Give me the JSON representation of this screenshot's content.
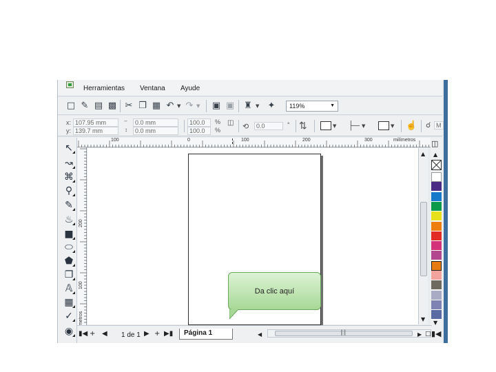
{
  "menu": [
    "Herramientas",
    "Ventana",
    "Ayude"
  ],
  "toolbar": {
    "zoom_value": "119%"
  },
  "property_bar": {
    "x_label": "x:",
    "x_value": "107.95 mm",
    "y_label": "y:",
    "y_value": "139.7 mm",
    "w_value": "0.0 mm",
    "h_value": "0.0 mm",
    "scale_x": "100.0",
    "scale_y": "100.0",
    "percent_x": "%",
    "percent_y": "%",
    "rotation_value": "0.0",
    "degree_symbol": "°",
    "font_partial": "M"
  },
  "ruler": {
    "top_labels": [
      "100",
      "0",
      "100",
      "200",
      "300"
    ],
    "top_unit": "milímetros",
    "left_labels": [
      "200",
      "100"
    ],
    "left_unit": "milímetros"
  },
  "canvas": {
    "callout_text": "Da clic aquí"
  },
  "bottom": {
    "page_count": "1 de 1",
    "page_tab": "Página 1"
  },
  "palette_colors": [
    "#ffffff",
    "#4b2a86",
    "#1679c9",
    "#0a9a4a",
    "#e8e01b",
    "#ef7e10",
    "#e22b25",
    "#d3327a",
    "#b2468f",
    "#ffffff",
    "#f2a49c",
    "#6e6a5f",
    "#a9abc4",
    "#7f83b4",
    "#5a6aa3"
  ],
  "icons": {
    "tools": [
      "pick-tool-icon",
      "shape-tool-icon",
      "crop-tool-icon",
      "zoom-tool-icon",
      "freehand-tool-icon",
      "smart-fill-icon",
      "rectangle-tool-icon",
      "ellipse-tool-icon",
      "polygon-tool-icon",
      "basic-shapes-icon",
      "text-tool-icon",
      "interactive-effects-icon",
      "eyedropper-icon",
      "outline-tool-icon"
    ]
  }
}
